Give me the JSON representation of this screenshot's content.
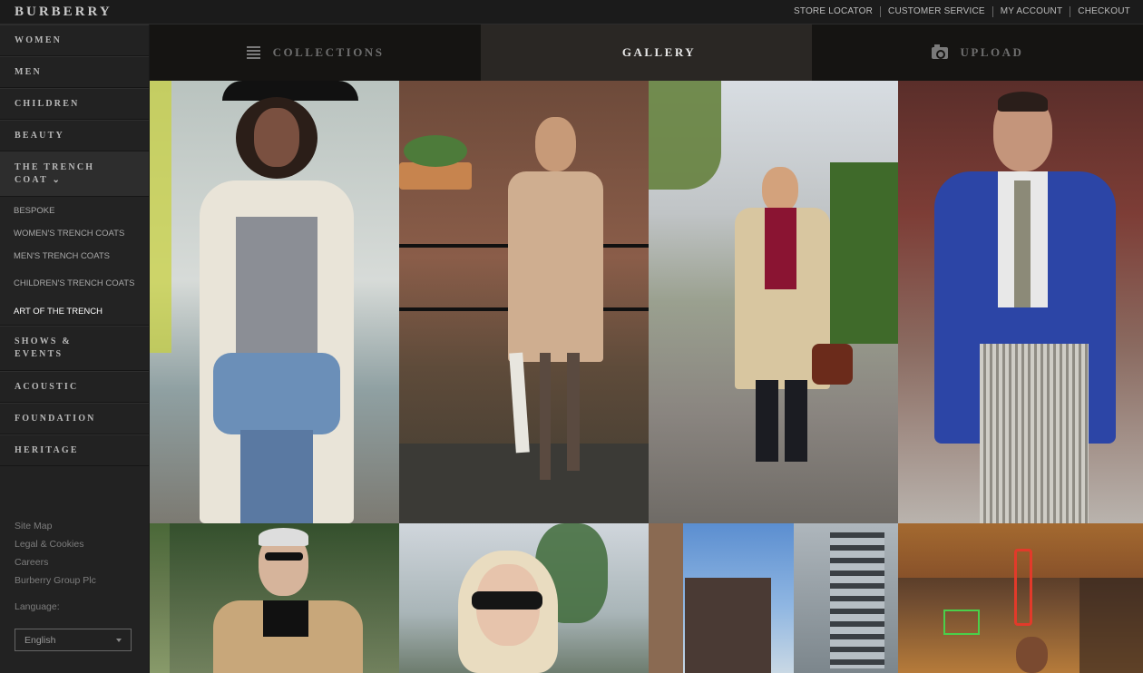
{
  "brand": "BURBERRY",
  "top_links": [
    "STORE LOCATOR",
    "CUSTOMER SERVICE",
    "MY ACCOUNT",
    "CHECKOUT"
  ],
  "nav": {
    "women": "WOMEN",
    "men": "MEN",
    "children": "CHILDREN",
    "beauty": "BEAUTY",
    "trench_line1": "THE TRENCH",
    "trench_line2": "COAT",
    "trench_chevron": "⌄",
    "sub": {
      "bespoke": "BESPOKE",
      "womens": "WOMEN'S TRENCH COATS",
      "mens": "MEN'S TRENCH COATS",
      "childrens": "CHILDREN'S TRENCH COATS",
      "art": "ART OF THE TRENCH"
    },
    "shows_line1": "SHOWS &",
    "shows_line2": "EVENTS",
    "acoustic": "ACOUSTIC",
    "foundation": "FOUNDATION",
    "heritage": "HERITAGE"
  },
  "footer": {
    "site_map": "Site Map",
    "legal": "Legal & Cookies",
    "careers": "Careers",
    "group": "Burberry Group Plc",
    "language_label": "Language:",
    "language_value": "English"
  },
  "tabs": {
    "collections": "COLLECTIONS",
    "gallery": "GALLERY",
    "upload": "UPLOAD"
  },
  "gallery": {
    "photos": [
      "woman-white-trench-black-hat",
      "woman-trench-plaid-scarf-umbrella",
      "man-beige-trench-red-sweater",
      "man-blue-trench-glasses",
      "man-beige-trench-sunglasses",
      "woman-sunglasses-blonde",
      "city-skyline-street",
      "man-market-neon-sign"
    ]
  },
  "colors": {
    "accent_active_tab": "#2a2724",
    "sidebar_bg": "#222222",
    "topbar_bg": "#1b1b1b"
  }
}
